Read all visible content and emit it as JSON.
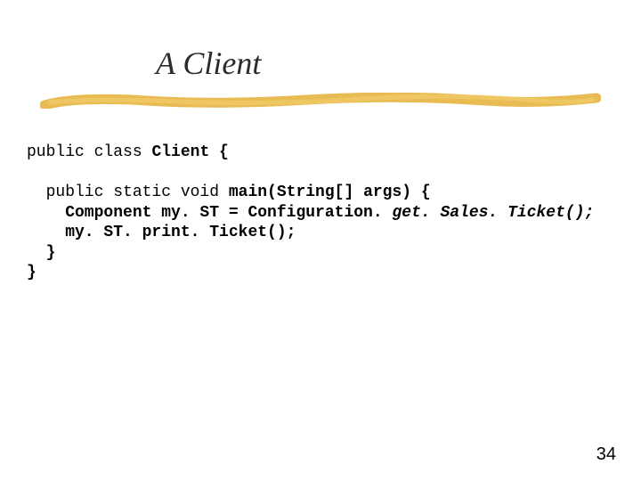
{
  "title": "A Client",
  "code": {
    "l1a": "public class ",
    "l1b": "Client {",
    "l2a": "  public static void ",
    "l2b": "main(String[] args) {",
    "l3a": "    Component my. ST = Configuration. ",
    "l3b": "get. Sales. Ticket();",
    "l4": "    my. ST. print. Ticket();",
    "l5": "  }",
    "l6": "}"
  },
  "page_number": "34"
}
